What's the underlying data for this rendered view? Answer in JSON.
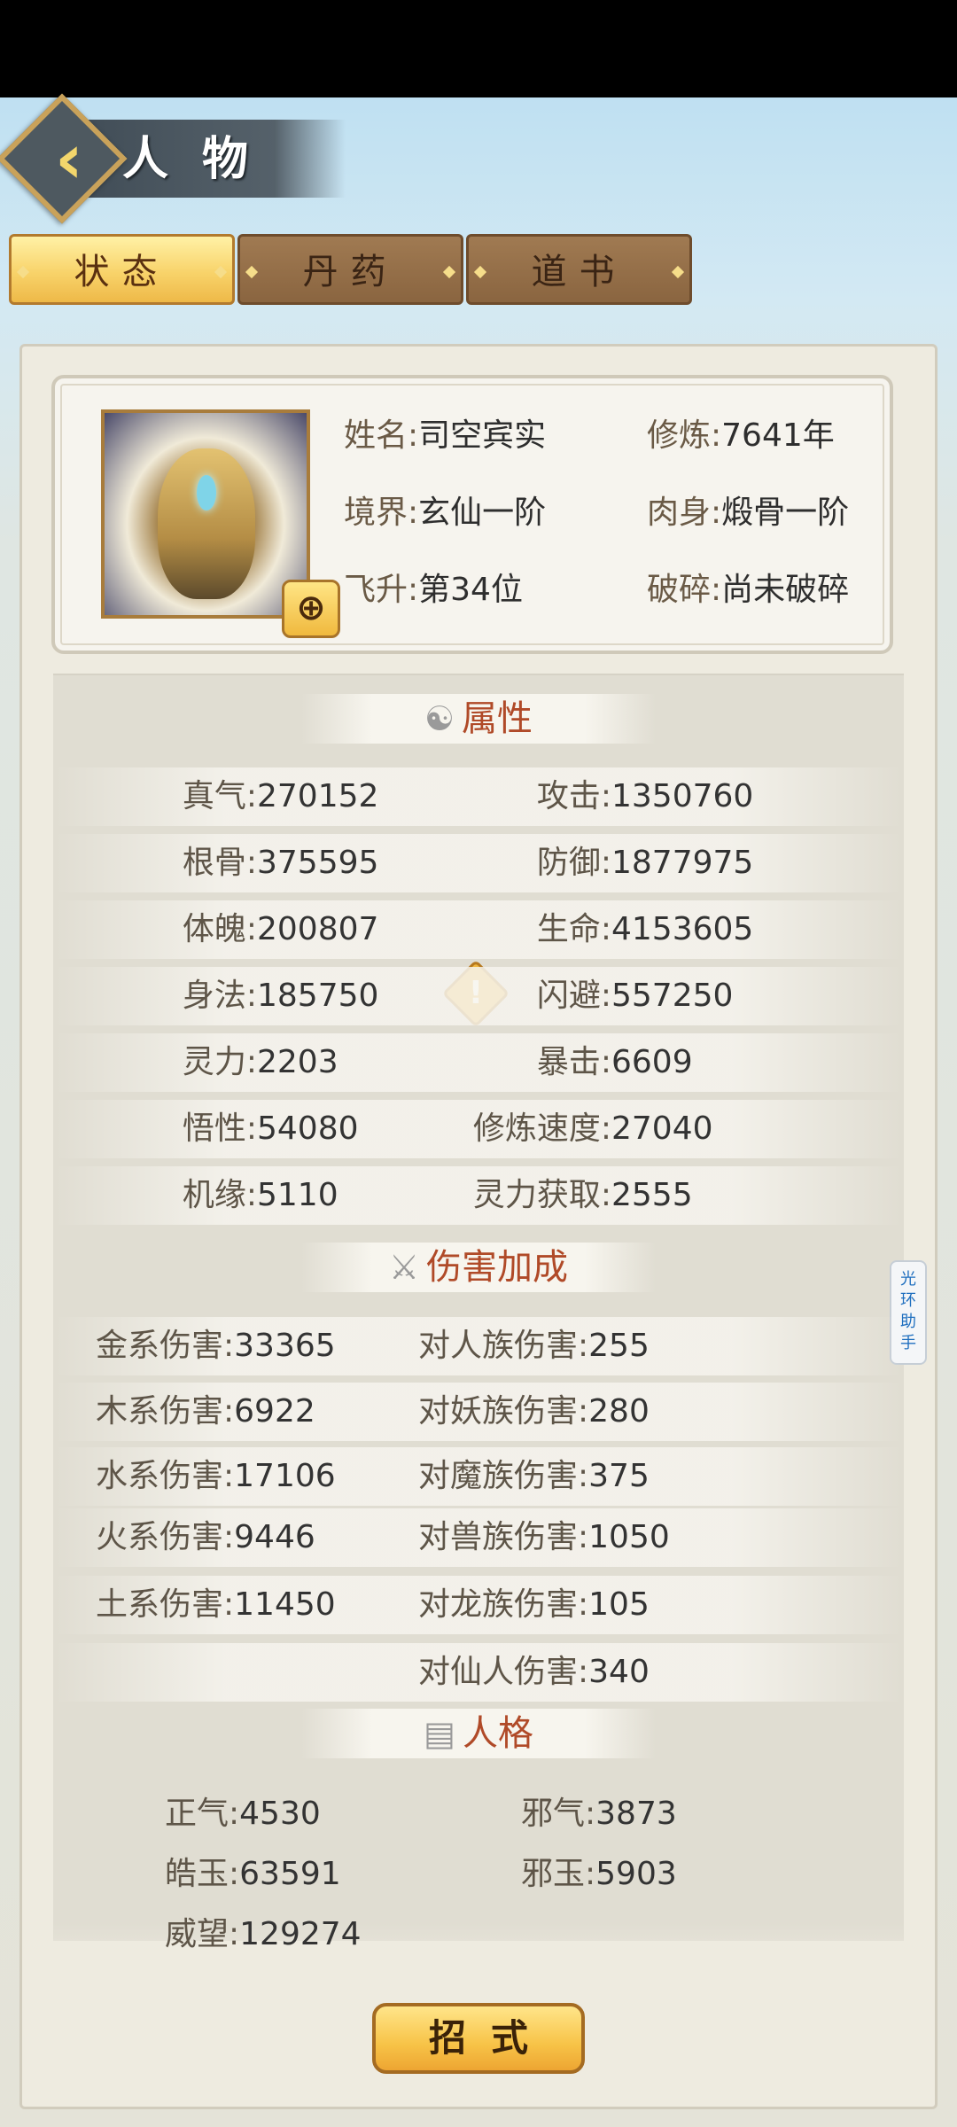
{
  "header": {
    "title": "人物"
  },
  "tabs": [
    {
      "label": "状态",
      "active": true
    },
    {
      "label": "丹药",
      "active": false
    },
    {
      "label": "道书",
      "active": false
    }
  ],
  "profile": {
    "name_label": "姓名:",
    "name": "司空宾实",
    "cultivation_label": "修炼:",
    "cultivation": "7641年",
    "realm_label": "境界:",
    "realm": "玄仙一阶",
    "body_label": "肉身:",
    "body": "煅骨一阶",
    "ascension_label": "飞升:",
    "ascension": "第34位",
    "shatter_label": "破碎:",
    "shatter": "尚未破碎",
    "zoom_icon": "zoom-in-icon"
  },
  "attributes": {
    "title": "属性",
    "rows": [
      {
        "l_label": "真气:",
        "l_value": "270152",
        "r_label": "攻击:",
        "r_value": "1350760"
      },
      {
        "l_label": "根骨:",
        "l_value": "375595",
        "r_label": "防御:",
        "r_value": "1877975"
      },
      {
        "l_label": "体魄:",
        "l_value": "200807",
        "r_label": "生命:",
        "r_value": "4153605"
      },
      {
        "l_label": "身法:",
        "l_value": "185750",
        "r_label": "闪避:",
        "r_value": "557250"
      },
      {
        "l_label": "灵力:",
        "l_value": "2203",
        "r_label": "暴击:",
        "r_value": "6609"
      },
      {
        "l_label": "悟性:",
        "l_value": "54080",
        "r_label": "修炼速度:",
        "r_value": "27040"
      },
      {
        "l_label": "机缘:",
        "l_value": "5110",
        "r_label": "灵力获取:",
        "r_value": "2555"
      }
    ]
  },
  "damage": {
    "title": "伤害加成",
    "left": [
      {
        "label": "金系伤害:",
        "value": "33365"
      },
      {
        "label": "木系伤害:",
        "value": "6922"
      },
      {
        "label": "水系伤害:",
        "value": "17106"
      },
      {
        "label": "火系伤害:",
        "value": "9446"
      },
      {
        "label": "土系伤害:",
        "value": "11450"
      }
    ],
    "right": [
      {
        "label": "对人族伤害:",
        "value": "255"
      },
      {
        "label": "对妖族伤害:",
        "value": "280"
      },
      {
        "label": "对魔族伤害:",
        "value": "375"
      },
      {
        "label": "对兽族伤害:",
        "value": "1050"
      },
      {
        "label": "对龙族伤害:",
        "value": "105"
      },
      {
        "label": "对仙人伤害:",
        "value": "340"
      }
    ]
  },
  "personality": {
    "title": "人格",
    "rows": [
      {
        "l_label": "正气:",
        "l_value": "4530",
        "r_label": "邪气:",
        "r_value": "3873"
      },
      {
        "l_label": "皓玉:",
        "l_value": "63591",
        "r_label": "邪玉:",
        "r_value": "5903"
      },
      {
        "l_label": "威望:",
        "l_value": "129274"
      }
    ]
  },
  "side_tab": {
    "label": "光环助手"
  },
  "bottom_button": {
    "label": "招式"
  }
}
